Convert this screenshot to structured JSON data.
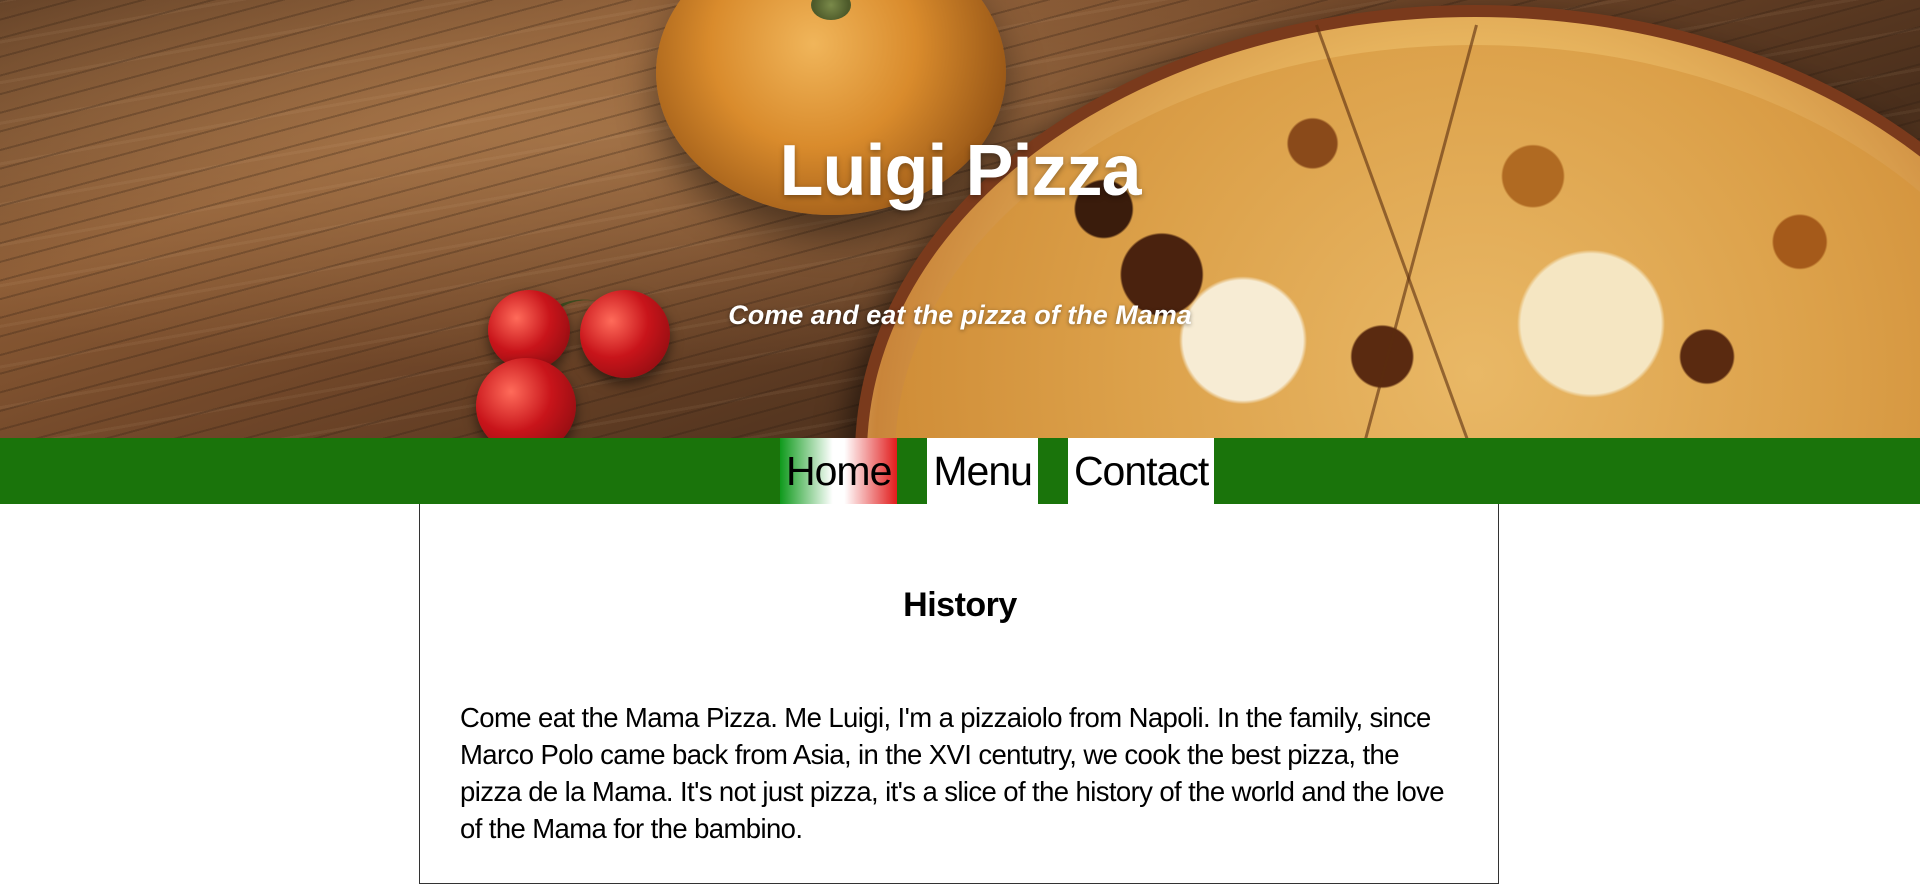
{
  "site": {
    "title": "Luigi Pizza",
    "tagline": "Come and eat the pizza of the Mama"
  },
  "nav": {
    "items": [
      {
        "label": "Home",
        "active": true
      },
      {
        "label": "Menu",
        "active": false
      },
      {
        "label": "Contact",
        "active": false
      }
    ]
  },
  "main": {
    "section_title": "History",
    "paragraph": "Come eat the Mama Pizza. Me Luigi, I'm a pizzaiolo from Napoli. In the family, since Marco Polo came back from Asia, in the XVI centutry, we cook the best pizza, the pizza de la Mama. It's not just pizza, it's a slice of the history of the world and the love of the Mama for the bambino."
  },
  "colors": {
    "nav_background": "#1a740b",
    "active_gradient_left": "#0f9a1c",
    "active_gradient_right": "#e11b1b",
    "title_text": "#ffffff",
    "body_text": "#000000"
  }
}
